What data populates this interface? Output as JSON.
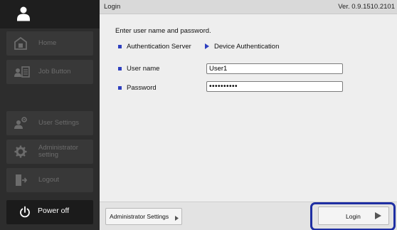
{
  "header": {
    "title": "Login",
    "version": "Ver. 0.9.1510.2101"
  },
  "sidebar": {
    "items": [
      {
        "label": "Home",
        "icon": "home-icon",
        "enabled": false
      },
      {
        "label": "Job Button",
        "icon": "job-button-icon",
        "enabled": false
      },
      {
        "label": "User Settings",
        "icon": "user-settings-icon",
        "enabled": false
      },
      {
        "label": "Administrator setting",
        "icon": "gear-icon",
        "enabled": false
      },
      {
        "label": "Logout",
        "icon": "logout-icon",
        "enabled": false
      }
    ],
    "power": {
      "label": "Power off",
      "icon": "power-icon"
    }
  },
  "main": {
    "instruction": "Enter user name and password.",
    "auth_server_label": "Authentication Server",
    "device_auth_label": "Device Authentication",
    "username_label": "User name",
    "username_value": "User1",
    "password_label": "Password",
    "password_value": "••••••••••"
  },
  "footer": {
    "admin_settings_label": "Administrator Settings",
    "login_label": "Login"
  },
  "colors": {
    "sidebar_bg": "#2d2d2d",
    "accent_bullet": "#2e3fbf",
    "highlight_border": "#1f2fa3"
  }
}
